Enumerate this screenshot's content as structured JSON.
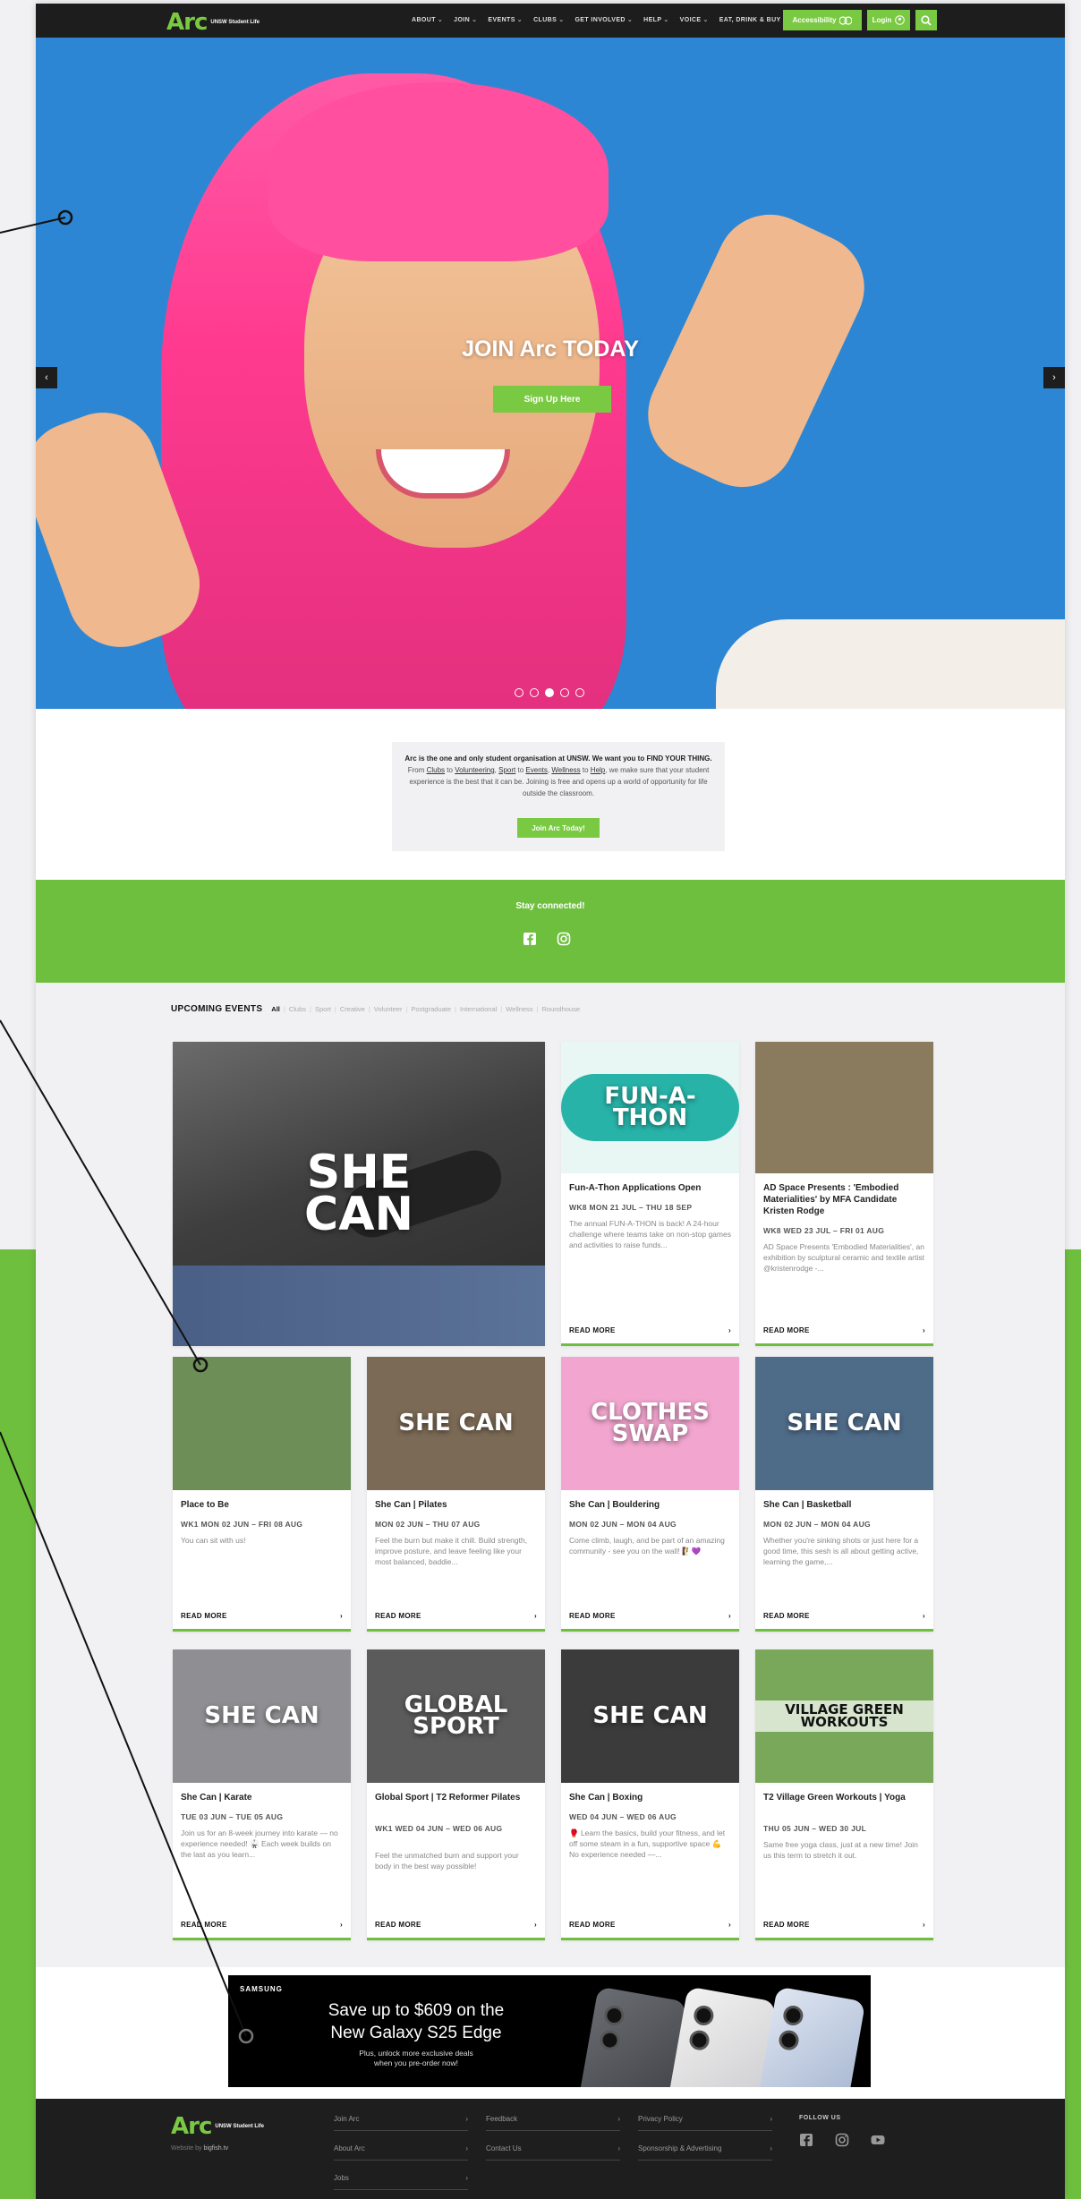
{
  "header": {
    "logo_text": "Arc",
    "logo_sub": "UNSW Student Life",
    "nav": [
      "ABOUT",
      "JOIN",
      "EVENTS",
      "CLUBS",
      "GET INVOLVED",
      "HELP",
      "VOICE",
      "EAT, DRINK & BUY"
    ],
    "accessibility_label": "Accessibility",
    "login_label": "Login",
    "icons": {
      "search": "search-icon",
      "accessibility": "accessibility-icon",
      "login": "user-icon"
    }
  },
  "hero": {
    "title": "JOIN Arc TODAY",
    "cta_label": "Sign Up Here",
    "prev_arrow": "‹",
    "next_arrow": "›",
    "slide_count": 5,
    "active_slide": 3
  },
  "intro": {
    "p1_bold": "Arc is the one and only student organisation at UNSW. We want you to FIND YOUR THING.",
    "p1_from": "From",
    "link_clubs": "Clubs",
    "to1": "to",
    "link_volunteering": "Volunteering",
    "comma1": ",",
    "link_sport": "Sport",
    "to2": "to",
    "link_events": "Events",
    "comma2": ",",
    "link_wellness": "Wellness",
    "to3": "to",
    "link_help": "Help",
    "p1_rest": ", we make sure that your student experience is the best that it can be. Joining is free and opens up a world of opportunity for life outside the classroom.",
    "cta_label": "Join Arc Today!"
  },
  "connected": {
    "title": "Stay connected!",
    "icons": [
      "facebook-icon",
      "instagram-icon"
    ]
  },
  "events": {
    "title": "UPCOMING EVENTS",
    "filters": [
      "All",
      "Clubs",
      "Sport",
      "Creative",
      "Volunteer",
      "Postgraduate",
      "International",
      "Wellness",
      "Roundhouse"
    ],
    "read_more": "READ MORE",
    "featured": {
      "image_label_1": "SHE",
      "image_label_2": "CAN"
    },
    "cards": [
      {
        "title": "Fun-A-Thon Applications Open",
        "date": "WK8 MON 21 JUL – THU 18 SEP",
        "desc": "The annual FUN-A-THON is back! A 24-hour challenge where teams take on non-stop games and activities to raise funds...",
        "img_text": "FUN-A-THON",
        "img_color": "#e8f6f4"
      },
      {
        "title": "AD Space Presents : 'Embodied Materialities' by MFA Candidate Kristen Rodge",
        "date": "WK8 WED 23 JUL – FRI 01 AUG",
        "desc": "AD Space Presents 'Embodied Materialities', an exhibition by sculptural ceramic and textile artist @kristenrodge -...",
        "img_text": "",
        "img_color": "#8a7a5e"
      },
      {
        "title": "Place to Be",
        "date": "WK1 MON 02 JUN – FRI 08 AUG",
        "desc": "You can sit with us!",
        "img_text": "",
        "img_color": "#6d8e57"
      },
      {
        "title": "She Can | Pilates",
        "date": "MON 02 JUN – THU 07 AUG",
        "desc": "Feel the burn but make it chill. Build strength, improve posture, and leave feeling like your most balanced, baddie...",
        "img_text": "SHE CAN",
        "img_color": "#7b6a55"
      },
      {
        "title": "She Can | Bouldering",
        "date": "MON 02 JUN – MON 04 AUG",
        "desc": "Come climb, laugh, and be part of an amazing community - see you on the wall! 🧗💜",
        "img_text": "CLOTHES SWAP",
        "img_color": "#f2a6cf"
      },
      {
        "title": "She Can | Basketball",
        "date": "MON 02 JUN – MON 04 AUG",
        "desc": "Whether you're sinking shots or just here for a good time, this sesh is all about getting active, learning the game,...",
        "img_text": "SHE CAN",
        "img_color": "#4e6b88"
      },
      {
        "title": "She Can | Karate",
        "date": "TUE 03 JUN – TUE 05 AUG",
        "desc": "Join us for an 8-week journey into karate — no experience needed! 🥋 Each week builds on the last as you learn...",
        "img_text": "SHE CAN",
        "img_color": "#8f8f93"
      },
      {
        "title": "Global Sport | T2 Reformer Pilates",
        "date": "WK1 WED 04 JUN – WED 06 AUG",
        "desc": "Feel the unmatched burn and support your body in the best way possible!",
        "img_text": "GLOBAL SPORT",
        "img_color": "#5b5b5b"
      },
      {
        "title": "She Can | Boxing",
        "date": "WED 04 JUN – WED 06 AUG",
        "desc": "🥊 Learn the basics, build your fitness, and let off some steam in a fun, supportive space 💪 No experience needed —...",
        "img_text": "SHE CAN",
        "img_color": "#3b3b3b"
      },
      {
        "title": "T2 Village Green Workouts | Yoga",
        "date": "THU 05 JUN – WED 30 JUL",
        "desc": "Same free yoga class, just at a new time! Join us this term to stretch it out.",
        "img_text": "VILLAGE GREEN WORKOUTS",
        "img_color": "#7aa85a"
      }
    ]
  },
  "ad": {
    "brand": "SAMSUNG",
    "headline_1": "Save up to $609 on the",
    "headline_2": "New Galaxy S25 Edge",
    "sub_1": "Plus, unlock more exclusive deals",
    "sub_2": "when you pre-order now!"
  },
  "footer": {
    "logo_text": "Arc",
    "logo_sub": "UNSW Student Life",
    "website_by_label": "Website by",
    "website_by_name": "bigfish.tv",
    "links": [
      "Join Arc",
      "Feedback",
      "Privacy Policy",
      "About Arc",
      "Contact Us",
      "Sponsorship & Advertising",
      "Jobs"
    ],
    "follow_label": "FOLLOW US",
    "social_icons": [
      "facebook-icon",
      "instagram-icon",
      "youtube-icon"
    ]
  },
  "colors": {
    "brand_green": "#7ac943",
    "band_green": "#6fbf3f",
    "header_dark": "#1d1d1d",
    "hero_blue": "#2d86d3"
  }
}
